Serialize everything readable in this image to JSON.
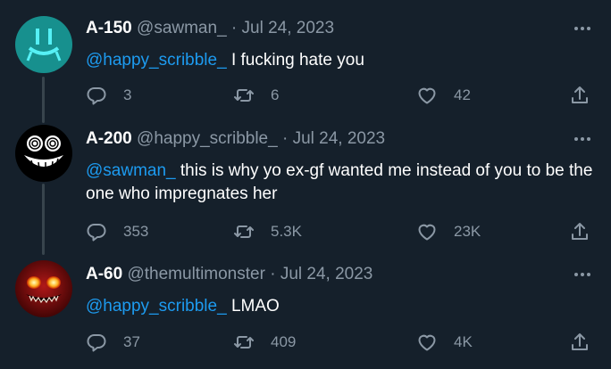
{
  "colors": {
    "background": "#15202b",
    "text": "#ffffff",
    "secondary": "#8b98a5",
    "link": "#1d9bf0",
    "thread_line": "#38444d"
  },
  "tweets": [
    {
      "name": "A-150",
      "handle": "@sawman_",
      "separator": "·",
      "date": "Jul 24, 2023",
      "mention": "@happy_scribble_",
      "text": "I fucking hate you",
      "replies": "3",
      "retweets": "6",
      "likes": "42",
      "avatar_icon": "teal-face-avatar"
    },
    {
      "name": "A-200",
      "handle": "@happy_scribble_",
      "separator": "·",
      "date": "Jul 24, 2023",
      "mention": "@sawman_",
      "text": "this is why yo ex-gf wanted me instead of you to be the one who impregnates her",
      "replies": "353",
      "retweets": "5.3K",
      "likes": "23K",
      "avatar_icon": "scribble-face-avatar"
    },
    {
      "name": "A-60",
      "handle": "@themultimonster",
      "separator": "·",
      "date": "Jul 24, 2023",
      "mention": "@happy_scribble_",
      "text": "LMAO",
      "replies": "37",
      "retweets": "409",
      "likes": "4K",
      "avatar_icon": "red-monster-avatar"
    }
  ],
  "icons": {
    "reply": "reply-icon",
    "retweet": "retweet-icon",
    "like": "heart-icon",
    "share": "share-icon",
    "more": "more-icon"
  }
}
